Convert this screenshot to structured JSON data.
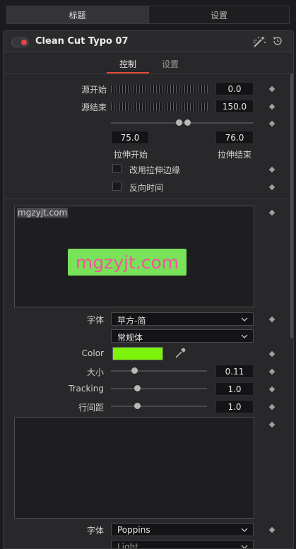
{
  "top_tabs": {
    "title": "标题",
    "settings": "设置"
  },
  "header": {
    "fx_name": "Clean Cut Typo 07",
    "enabled": true
  },
  "sub_tabs": {
    "control": "控制",
    "settings": "设置"
  },
  "timing": {
    "source_start_label": "源开始",
    "source_start_value": "0.0",
    "source_end_label": "源结束",
    "source_end_value": "150.0",
    "stretch_start_value": "75.0",
    "stretch_end_value": "76.0",
    "stretch_start_label": "拉伸开始",
    "stretch_end_label": "拉伸结束",
    "use_stretch_edges_label": "改用拉伸边缘",
    "use_stretch_edges_checked": false,
    "reverse_time_label": "反向时间",
    "reverse_time_checked": false
  },
  "text1": {
    "small_text": "mgzyjt.com",
    "preview_text": "mgzyjt.com",
    "font_label": "字体",
    "font_value": "苹方-简",
    "style_value": "常规体",
    "color_label": "Color",
    "color_hex": "#7cf40a",
    "size_label": "大小",
    "size_value": "0.11",
    "tracking_label": "Tracking",
    "tracking_value": "1.0",
    "line_spacing_label": "行间距",
    "line_spacing_value": "1.0"
  },
  "text2": {
    "font_label": "字体",
    "font_value": "Poppins",
    "style_value": "Light"
  },
  "colors": {
    "accent": "#e04a3a",
    "toggle_on": "#e64545",
    "preview_bg": "#78e258",
    "preview_fg": "#ff4fa3"
  },
  "icons": [
    "magic-wand-icon",
    "reset-icon",
    "chevron-down-icon",
    "eyedropper-icon",
    "keyframe-diamond-icon"
  ]
}
